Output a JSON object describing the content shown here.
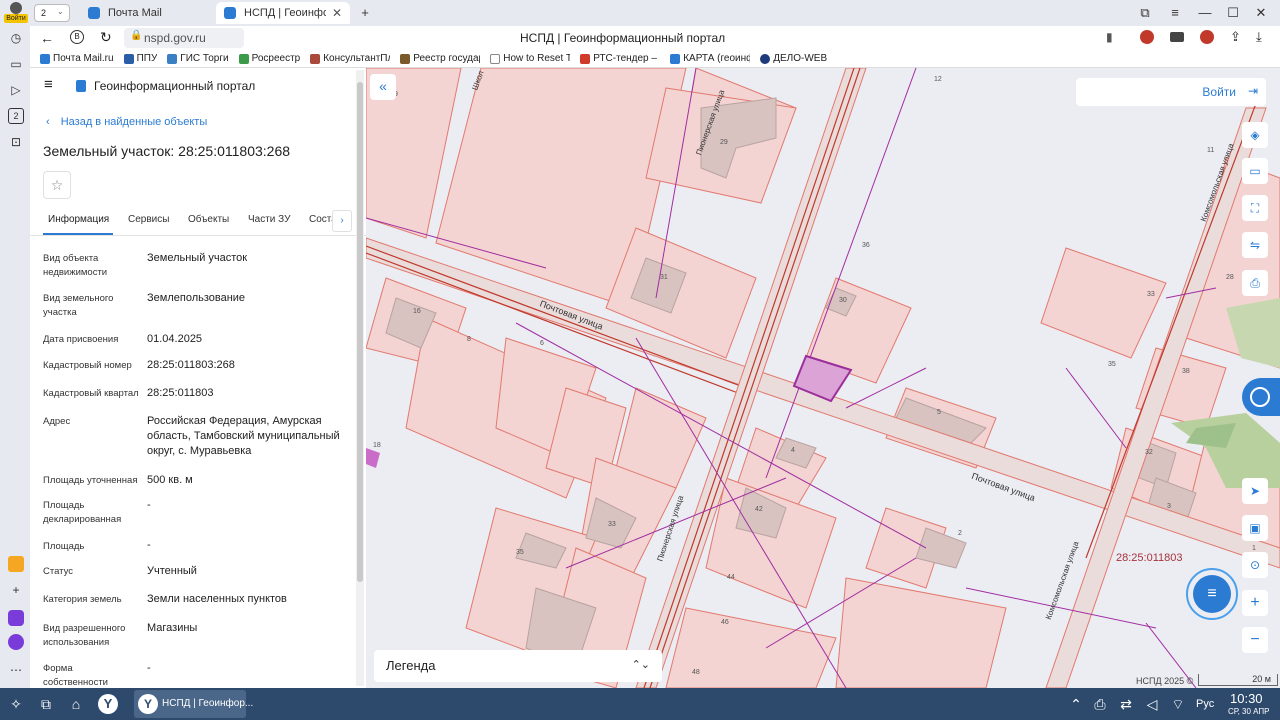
{
  "browser": {
    "profile_label": "Войти",
    "tab_count_badge": "2",
    "tabs": [
      {
        "label": "Почта Mail",
        "color": "#2b7bd3"
      },
      {
        "label": "НСПД | Геоинформа",
        "color": "#2b7bd3"
      }
    ],
    "new_tab": "+",
    "address": "nspd.gov.ru",
    "page_title": "НСПД | Геоинформационный портал",
    "bookmarks": [
      {
        "label": "Почта Mail.ru",
        "color": "#2b7bd3"
      },
      {
        "label": "ППУ",
        "color": "#2a5fa8"
      },
      {
        "label": "ГИС Торги",
        "color": "#3a7fc4"
      },
      {
        "label": "Росреестр",
        "color": "#3c9a4b"
      },
      {
        "label": "КонсультантПлю",
        "color": "#a94a3c"
      },
      {
        "label": "Реестр государ",
        "color": "#7a5a2a"
      },
      {
        "label": "How to Reset Th",
        "color": "#888888"
      },
      {
        "label": "РТС-тендер – э",
        "color": "#d03a2a"
      },
      {
        "label": "КАРТА (геоинф",
        "color": "#2b7bd3"
      },
      {
        "label": "ДЕЛО-WEB",
        "color": "#1f3a7a"
      }
    ]
  },
  "panel": {
    "portal_title": "Геоинформационный портал",
    "back_link": "Назад в найденные объекты",
    "object_title": "Земельный участок: 28:25:011803:268",
    "tabs": [
      "Информация",
      "Сервисы",
      "Объекты",
      "Части ЗУ",
      "Соста"
    ],
    "rows": [
      {
        "label": "Вид объекта недвижимости",
        "value": "Земельный участок"
      },
      {
        "label": "Вид земельного участка",
        "value": "Землепользование"
      },
      {
        "label": "Дата присвоения",
        "value": "01.04.2025"
      },
      {
        "label": "Кадастровый номер",
        "value": "28:25:011803:268"
      },
      {
        "label": "Кадастровый квартал",
        "value": "28:25:011803"
      },
      {
        "label": "Адрес",
        "value": "Российская Федерация, Амурская область, Тамбовский муниципальный округ, с. Муравьевка"
      },
      {
        "label": "Площадь уточненная",
        "value": "500 кв. м"
      },
      {
        "label": "Площадь декларированная",
        "value": "-"
      },
      {
        "label": "Площадь",
        "value": "-"
      },
      {
        "label": "Статус",
        "value": "Учтенный"
      },
      {
        "label": "Категория земель",
        "value": "Земли населенных пунктов"
      },
      {
        "label": "Вид разрешенного использования",
        "value": "Магазины"
      },
      {
        "label": "Форма собственности",
        "value": "-"
      }
    ]
  },
  "map": {
    "login": "Войти",
    "legend": "Легенда",
    "street_1": "Почтовая улица",
    "street_2": "Почтовая улица",
    "street_3": "Пионерская улица",
    "street_4": "Пионерская улица",
    "street_5": "Комсомольская улица",
    "street_6": "Комсомольская улица",
    "street_7": "Школ",
    "cadastral_label": "28:25:011803",
    "copyright": "НСПД 2025 ©",
    "scale": "20 м",
    "zoom_in": "+",
    "zoom_out": "−",
    "level_badge": "1",
    "house_numbers": [
      "29",
      "31",
      "30",
      "36",
      "33",
      "35",
      "38",
      "32",
      "3",
      "2",
      "4",
      "5",
      "6",
      "8",
      "16",
      "18",
      "33",
      "35",
      "42",
      "44",
      "46",
      "48",
      "12",
      "11",
      "28",
      "9"
    ]
  },
  "taskbar": {
    "task_label": "НСПД | Геоинфор...",
    "lang": "Рус",
    "time": "10:30",
    "date": "СР, 30 АПР"
  }
}
